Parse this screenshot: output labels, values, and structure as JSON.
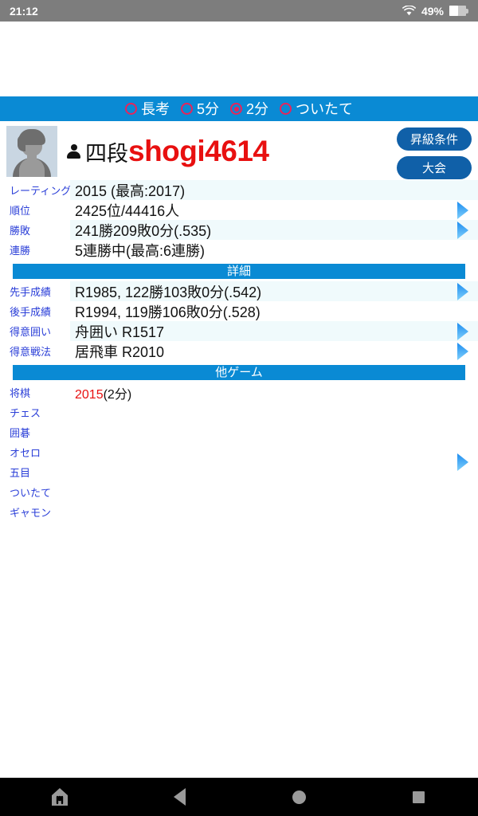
{
  "status_bar": {
    "time": "21:12",
    "battery_percent": "49%",
    "wifi_icon": "wifi-icon",
    "battery_icon": "battery-icon"
  },
  "mode_bar": {
    "options": [
      {
        "label": "長考",
        "selected": false
      },
      {
        "label": "5分",
        "selected": false
      },
      {
        "label": "2分",
        "selected": true
      },
      {
        "label": "ついたて",
        "selected": false
      }
    ]
  },
  "profile": {
    "avatar_icon": "avatar-placeholder-icon",
    "rank_icon": "person-icon",
    "rank": "四段",
    "username": "shogi4614",
    "buttons": [
      {
        "label": "昇級条件"
      },
      {
        "label": "大会"
      }
    ]
  },
  "stats": {
    "rows": [
      {
        "label": "レーティング",
        "value": "2015 (最高:2017)",
        "arrow": false
      },
      {
        "label": "順位",
        "value": "2425位/44416人",
        "arrow": true
      },
      {
        "label": "勝敗",
        "value": "241勝209敗0分(.535)",
        "arrow": true
      },
      {
        "label": "連勝",
        "value": "5連勝中(最高:6連勝)",
        "arrow": false
      }
    ]
  },
  "detail_section": {
    "title": "詳細",
    "rows": [
      {
        "label": "先手成績",
        "value": "R1985, 122勝103敗0分(.542)",
        "arrow": true
      },
      {
        "label": "後手成績",
        "value": "R1994, 119勝106敗0分(.528)",
        "arrow": false
      },
      {
        "label": "得意囲い",
        "value": "舟囲い R1517",
        "arrow": true
      },
      {
        "label": "得意戦法",
        "value": "居飛車 R2010",
        "arrow": true
      }
    ]
  },
  "other_games_section": {
    "title": "他ゲーム",
    "rows": [
      {
        "label": "将棋",
        "rating": "2015",
        "suffix": "(2分)"
      },
      {
        "label": "チェス",
        "rating": "",
        "suffix": ""
      },
      {
        "label": "囲碁",
        "rating": "",
        "suffix": ""
      },
      {
        "label": "オセロ",
        "rating": "",
        "suffix": ""
      },
      {
        "label": "五目",
        "rating": "",
        "suffix": ""
      },
      {
        "label": "ついたて",
        "rating": "",
        "suffix": ""
      },
      {
        "label": "ギャモン",
        "rating": "",
        "suffix": ""
      }
    ]
  },
  "nav_bar": {
    "buttons": [
      {
        "icon": "app-home-icon"
      },
      {
        "icon": "back-icon"
      },
      {
        "icon": "home-icon"
      },
      {
        "icon": "recents-icon"
      }
    ]
  },
  "colors": {
    "accent_blue": "#0a8ad4",
    "button_blue": "#1060a8",
    "label_blue": "#2b3fd8",
    "username_red": "#e81010",
    "radio_red": "#e8245a",
    "row_tint": "#f0fafc",
    "statusbar_gray": "#7d7d7d"
  }
}
